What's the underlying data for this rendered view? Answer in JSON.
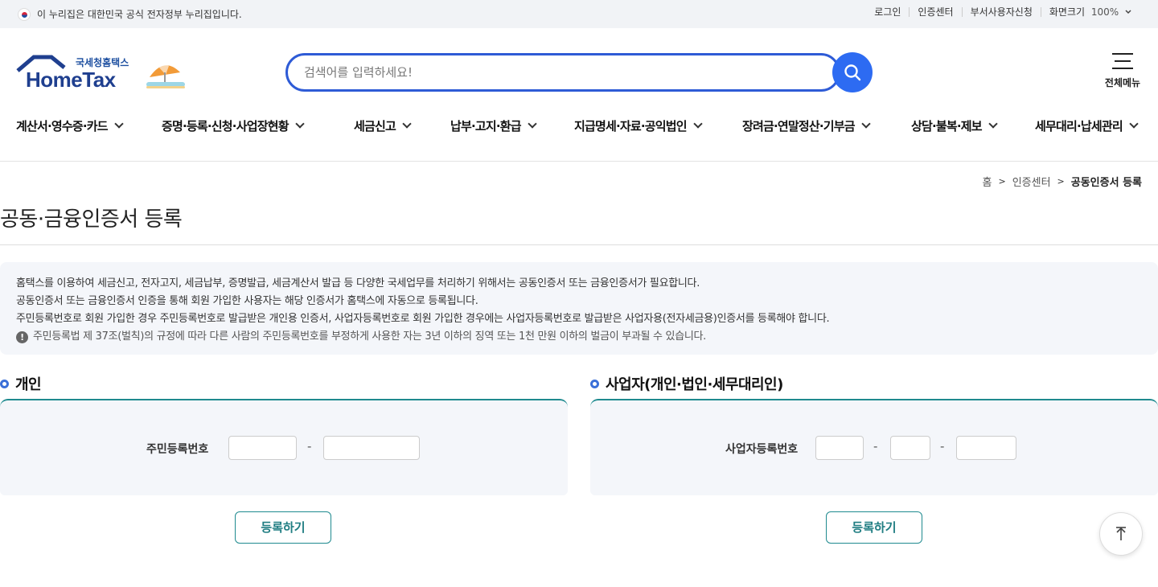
{
  "gov_banner": {
    "text": "이 누리집은 대한민국 공식 전자정부 누리집입니다."
  },
  "util_links": [
    {
      "label": "로그인"
    },
    {
      "label": "인증센터"
    },
    {
      "label": "부서사용자신청"
    },
    {
      "label": "화면크기"
    }
  ],
  "zoom": {
    "value": "100%"
  },
  "logo": {
    "subtitle": "국세청홈택스",
    "name": "HomeTax"
  },
  "search": {
    "placeholder": "검색어를 입력하세요!"
  },
  "all_menu": {
    "label": "전체메뉴"
  },
  "gnb": [
    {
      "label": "계산서·영수증·카드"
    },
    {
      "label": "증명·등록·신청·사업장현황"
    },
    {
      "label": "세금신고"
    },
    {
      "label": "납부·고지·환급"
    },
    {
      "label": "지급명세·자료·공익법인"
    },
    {
      "label": "장려금·연말정산·기부금"
    },
    {
      "label": "상담·불복·제보"
    },
    {
      "label": "세무대리·납세관리"
    }
  ],
  "breadcrumb": {
    "home": "홈",
    "parent": "인증센터",
    "current": "공동인증서 등록"
  },
  "page_title": "공동·금융인증서 등록",
  "notice": {
    "lines": [
      "홈택스를 이용하여 세금신고, 전자고지, 세금납부, 증명발급, 세금계산서 발급 등 다양한 국세업무를 처리하기 위해서는 공동인증서 또는 금융인증서가 필요합니다.",
      "공동인증서 또는 금융인증서 인증을 통해 회원 가입한 사용자는 해당 인증서가 홈택스에 자동으로 등록됩니다.",
      "주민등록번호로 회원 가입한 경우 주민등록번호로 발급받은 개인용 인증서, 사업자등록번호로 회원 가입한 경우에는 사업자등록번호로 발급받은 사업자용(전자세금용)인증서를 등록해야 합니다."
    ],
    "warning": "주민등록법 제 37조(벌칙)의 규정에 따라 다른 사람의 주민등록번호를 부정하게 사용한 자는 3년 이하의 징역 또는 1천 만원 이하의 벌금이 부과될 수 있습니다."
  },
  "personal": {
    "title": "개인",
    "field_label": "주민등록번호",
    "separator": "-",
    "button": "등록하기"
  },
  "business": {
    "title": "사업자(개인·법인·세무대리인)",
    "field_label": "사업자등록번호",
    "separator": "-",
    "button": "등록하기"
  },
  "colors": {
    "primary": "#2d6bf2",
    "teal": "#1f8a8f",
    "panel_bg": "#f4f6fa"
  },
  "icons": {
    "search": "search-icon",
    "menu": "hamburger-icon",
    "top": "arrow-up-icon",
    "warning": "exclamation-icon"
  }
}
